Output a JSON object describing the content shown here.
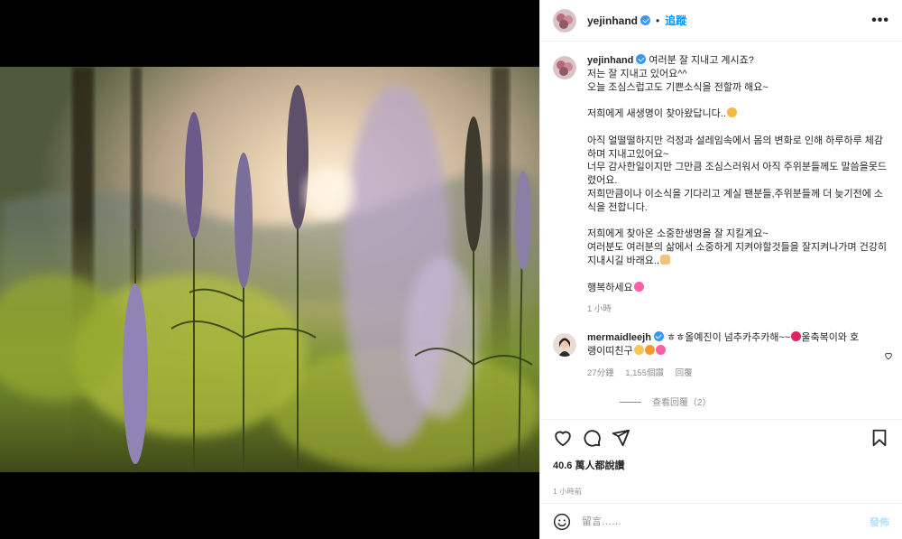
{
  "post": {
    "username": "yejinhand",
    "follow_label": "追蹤",
    "separator": "•",
    "more_label": "•••"
  },
  "caption": {
    "username": "yejinhand",
    "lines": [
      "여러분 잘 지내고 계시죠?",
      "저는 잘 지내고 있어요^^",
      "오늘 조심스럽고도 기쁜소식을 전할까 해요~",
      "",
      "저희에게 새생명이 찾아왔답니다..",
      "",
      "아직 얼떨떨하지만 걱정과 설레임속에서 몸의 변화로 인해 하루하루 체감",
      "하며 지내고있어요~",
      "너무 감사한일이지만 그만큼 조심스러워서 아직 주위분들께도 말씀을못드",
      "렸어요.",
      "저희만큼이나 이소식을 기다리고 계실 팬분들,주위분들께 더 늦기전에 소",
      "식을 전합니다.",
      "",
      "저희에게 찾아온 소중한생명을 잘 지킬게요~",
      "여러분도 여러분의 삶에서 소중하게 지켜야할것들을 잘지켜나가며 건강히",
      "지내시길 바래요..",
      "",
      "행복하세요"
    ],
    "time": "1 小時"
  },
  "comment": {
    "username": "mermaidleejh",
    "text_1": "ㅎㅎ올예진이 넘추카추카해~~",
    "text_2": "울축복이와 호",
    "text_3": "랭이띠친구",
    "time": "27分鐘",
    "likes": "1,155個讚",
    "reply_label": "回覆",
    "view_replies": "查看回覆（2）"
  },
  "footer": {
    "likes_summary": "40.6 萬人都說讚",
    "time_ago": "1 小時前"
  },
  "add_comment": {
    "placeholder": "留言……",
    "post_label": "發佈"
  },
  "icons": {
    "heart": "heart-icon",
    "comment": "comment-icon",
    "share": "share-icon",
    "bookmark": "bookmark-icon",
    "emoji": "smile-icon"
  },
  "colors": {
    "accent": "#0095f6",
    "verified": "#3897f0",
    "post_disabled": "#b2dffc",
    "muted": "#8e8e8e",
    "comment_heart": "#ed4956"
  }
}
